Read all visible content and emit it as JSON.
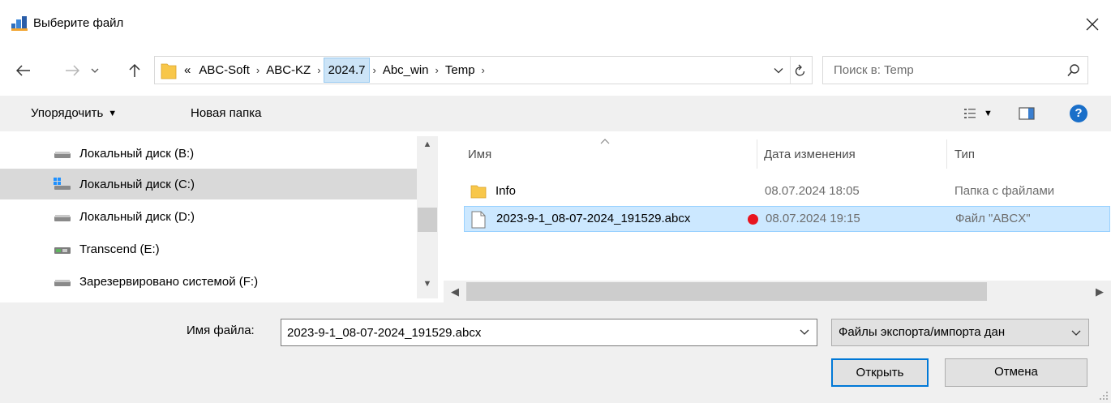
{
  "window": {
    "title": "Выберите файл",
    "close_glyph": "✕"
  },
  "nav": {
    "back_icon": "arrow-left-icon",
    "forward_icon": "arrow-right-icon",
    "recent_icon": "chevron-down-icon",
    "up_icon": "arrow-up-icon",
    "breadcrumb": {
      "overflow": "«",
      "separator": "›",
      "items": [
        "ABC-Soft",
        "ABC-KZ",
        "2024.7",
        "Abc_win",
        "Temp"
      ],
      "highlighted_index": 2
    },
    "search_placeholder": "Поиск в: Temp"
  },
  "toolbar": {
    "organize_label": "Упорядочить",
    "new_folder_label": "Новая папка",
    "help_glyph": "?"
  },
  "sidebar": {
    "items": [
      {
        "label": "Локальный диск (B:)",
        "icon": "drive-icon",
        "selected": false
      },
      {
        "label": "Локальный диск (C:)",
        "icon": "windows-drive-icon",
        "selected": true
      },
      {
        "label": "Локальный диск (D:)",
        "icon": "drive-icon",
        "selected": false
      },
      {
        "label": "Transcend (E:)",
        "icon": "usb-drive-icon",
        "selected": false
      },
      {
        "label": "Зарезервировано системой (F:)",
        "icon": "drive-icon",
        "selected": false
      }
    ]
  },
  "files": {
    "columns": {
      "name": "Имя",
      "date": "Дата изменения",
      "type": "Тип"
    },
    "rows": [
      {
        "name": "Info",
        "date": "08.07.2024 18:05",
        "type": "Папка с файлами",
        "icon": "folder-icon",
        "selected": false
      },
      {
        "name": "2023-9-1_08-07-2024_191529.abcx",
        "date": "08.07.2024 19:15",
        "type": "Файл \"ABCX\"",
        "icon": "file-icon",
        "selected": true
      }
    ]
  },
  "footer": {
    "filename_label": "Имя файла:",
    "filename_value": "2023-9-1_08-07-2024_191529.abcx",
    "filetype_value": "Файлы экспорта/импорта дан",
    "open_label": "Открыть",
    "cancel_label": "Отмена"
  },
  "colors": {
    "selection": "#cce8ff",
    "sidebar_selection": "#d9d9d9",
    "accent": "#0078d7",
    "marker": "#e8141e",
    "folder": "#f8c74a"
  }
}
